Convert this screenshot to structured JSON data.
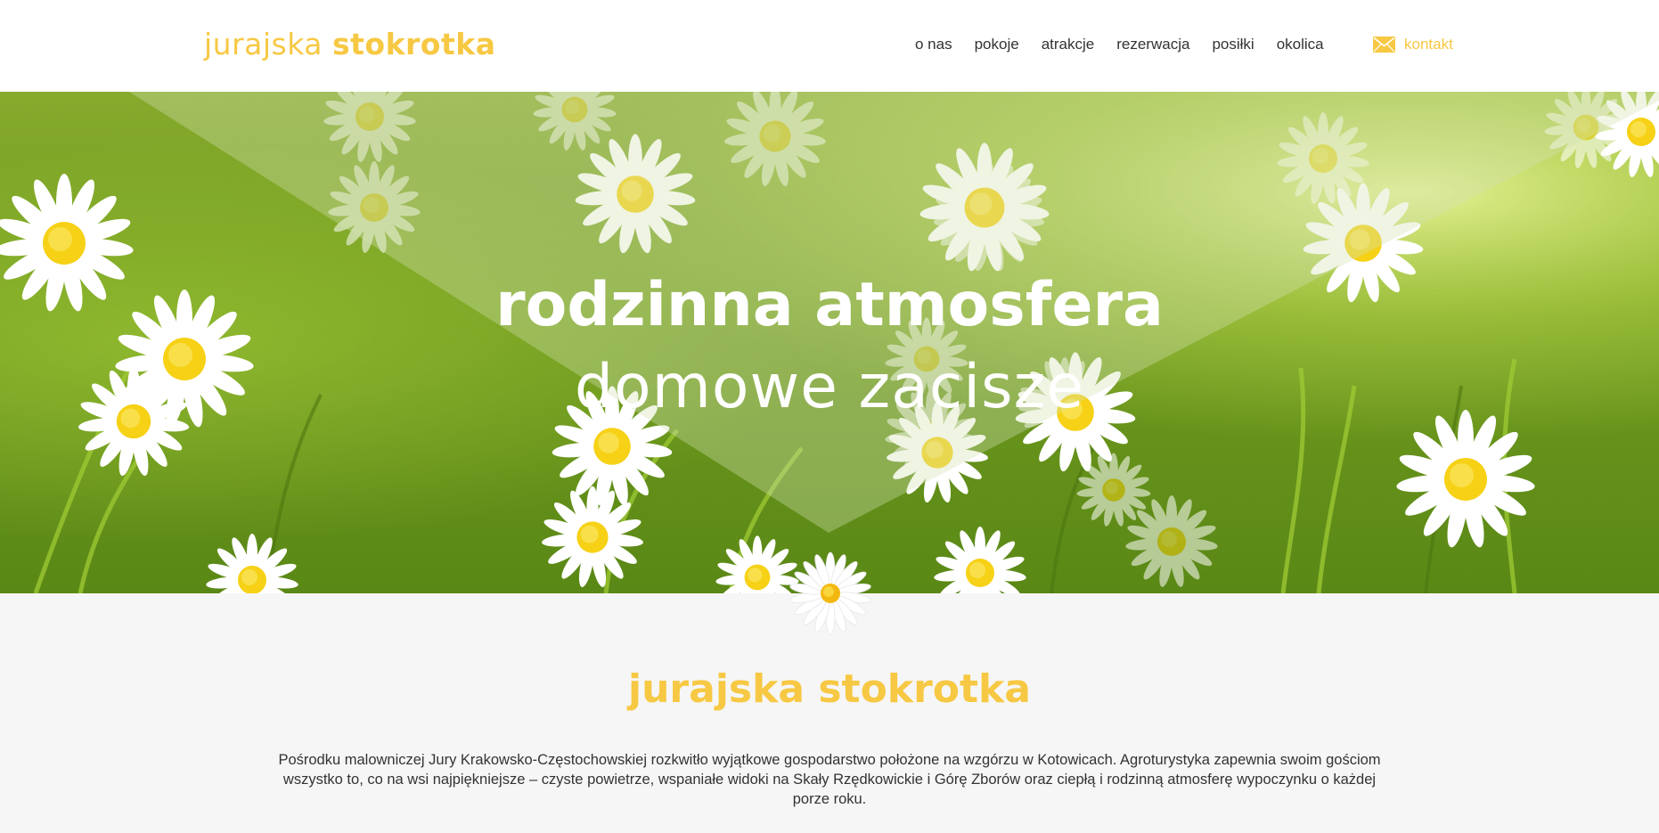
{
  "header": {
    "logo": {
      "light": "jurajska",
      "bold": "stokrotka"
    },
    "nav": [
      "o nas",
      "pokoje",
      "atrakcje",
      "rezerwacja",
      "posiłki",
      "okolica"
    ],
    "contact_label": "kontakt",
    "contact_icon": "envelope-icon"
  },
  "hero": {
    "title_line1": "rodzinna atmosfera",
    "title_line2": "domowe zacisze"
  },
  "about": {
    "title": "jurajska stokrotka",
    "text": "Pośrodku malowniczej Jury Krakowsko-Częstochowskiej rozkwitło wyjątkowe gospodarstwo położone na wzgórzu w Kotowicach. Agroturystyka zapewnia swoim gościom wszystko to, co na wsi najpiękniejsze – czyste powietrze, wspaniałe widoki na Skały Rzędkowickie i Górę Zborów oraz ciepłą i rodzinną atmosferę wypoczynku o każdej porze roku."
  },
  "colors": {
    "accent": "#f7c843",
    "text": "#333333",
    "grass_dark": "#4f7a12",
    "grass_light": "#a9d03a",
    "section_bg": "#f6f6f6"
  }
}
